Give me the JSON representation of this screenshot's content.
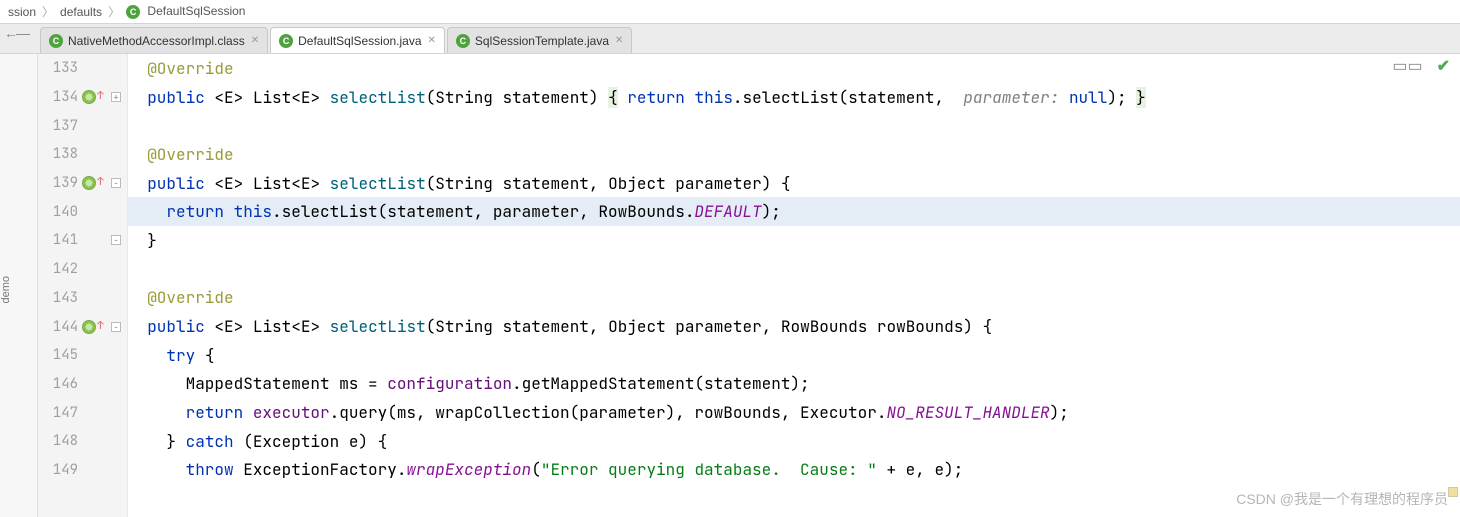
{
  "breadcrumb": {
    "part1": "ssion",
    "part2": "defaults",
    "class_label": "DefaultSqlSession"
  },
  "left_strip": {
    "label": "demo"
  },
  "tabs": [
    {
      "label": "NativeMethodAccessorImpl.class",
      "active": false
    },
    {
      "label": "DefaultSqlSession.java",
      "active": true
    },
    {
      "label": "SqlSessionTemplate.java",
      "active": false
    }
  ],
  "gutter": [
    {
      "num": "133"
    },
    {
      "num": "134",
      "override": true,
      "fold": "+"
    },
    {
      "num": "137"
    },
    {
      "num": "138"
    },
    {
      "num": "139",
      "override": true,
      "fold": "-"
    },
    {
      "num": "140",
      "highlight": true
    },
    {
      "num": "141",
      "fold": "-"
    },
    {
      "num": "142"
    },
    {
      "num": "143"
    },
    {
      "num": "144",
      "override": true,
      "fold": "-"
    },
    {
      "num": "145"
    },
    {
      "num": "146"
    },
    {
      "num": "147"
    },
    {
      "num": "148"
    },
    {
      "num": "149"
    }
  ],
  "code": {
    "l133": {
      "indent": "  ",
      "annot": "@Override"
    },
    "l134": {
      "indent": "  ",
      "kw1": "public",
      "gen": "<E>",
      "type": "List",
      "gentype": "<E>",
      "method": "selectList",
      "args_open": "(String statement) ",
      "brace_open": "{",
      "ret": " return ",
      "this": "this",
      "dot_call": ".selectList(statement,  ",
      "param_lbl": "parameter:",
      "null": " null",
      "close": "); ",
      "brace_close": "}"
    },
    "l138": {
      "indent": "  ",
      "annot": "@Override"
    },
    "l139": {
      "indent": "  ",
      "kw1": "public",
      "gen": "<E>",
      "type": "List",
      "gentype": "<E>",
      "method": "selectList",
      "sig": "(String statement, Object parameter) {"
    },
    "l140": {
      "indent": "    ",
      "ret": "return ",
      "this": "this",
      "call": ".selectList(statement, parameter, RowBounds.",
      "const": "DEFAULT",
      "end": ");"
    },
    "l141": {
      "indent": "  ",
      "brace": "}"
    },
    "l143": {
      "indent": "  ",
      "annot": "@Override"
    },
    "l144": {
      "indent": "  ",
      "kw1": "public",
      "gen": "<E>",
      "type": "List",
      "gentype": "<E>",
      "method": "selectList",
      "sig": "(String statement, Object parameter, RowBounds rowBounds) {"
    },
    "l145": {
      "indent": "    ",
      "kw": "try",
      "brace": " {"
    },
    "l146": {
      "indent": "      ",
      "type": "MappedStatement ms = ",
      "field": "configuration",
      "call": ".getMappedStatement(statement);"
    },
    "l147": {
      "indent": "      ",
      "ret": "return ",
      "field": "executor",
      "call1": ".query(ms, wrapCollection(parameter), rowBounds, Executor.",
      "const": "NO_RESULT_HANDLER",
      "end": ");"
    },
    "l148": {
      "indent": "    ",
      "close": "}",
      "catch": " catch ",
      "ex": "(Exception e) {"
    },
    "l149": {
      "indent": "      ",
      "throw": "throw ",
      "cls": "ExceptionFactory.",
      "meth": "wrapException",
      "open": "(",
      "str": "\"Error querying database.  Cause: \"",
      "rest": " + e, e);"
    }
  },
  "watermark": "CSDN @我是一个有理想的程序员"
}
